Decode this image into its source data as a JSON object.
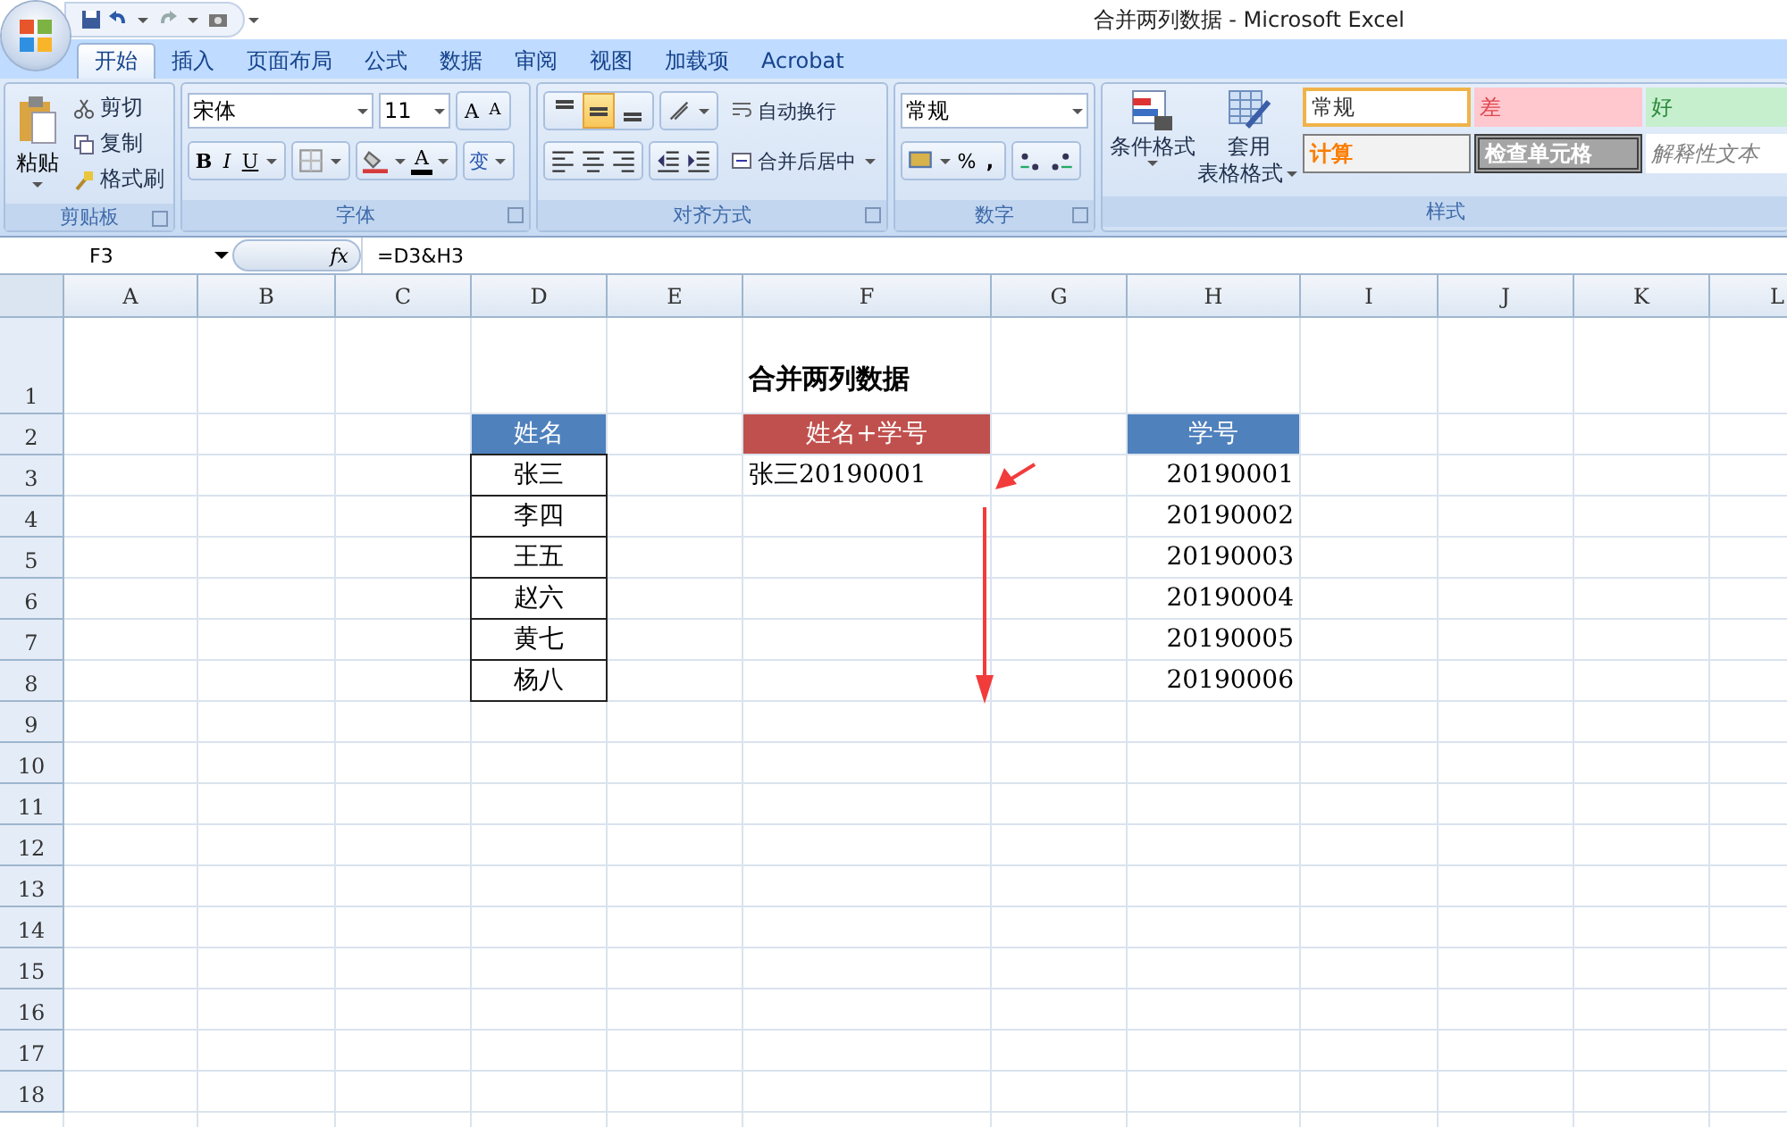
{
  "window": {
    "title": "合并两列数据 - Microsoft Excel"
  },
  "tabs": [
    {
      "label": "开始",
      "selected": true
    },
    {
      "label": "插入",
      "selected": false
    },
    {
      "label": "页面布局",
      "selected": false
    },
    {
      "label": "公式",
      "selected": false
    },
    {
      "label": "数据",
      "selected": false
    },
    {
      "label": "审阅",
      "selected": false
    },
    {
      "label": "视图",
      "selected": false
    },
    {
      "label": "加载项",
      "selected": false
    },
    {
      "label": "Acrobat",
      "selected": false
    }
  ],
  "ribbon": {
    "clipboard": {
      "label": "剪贴板",
      "paste": "粘贴",
      "cut": "剪切",
      "copy": "复制",
      "format_painter": "格式刷"
    },
    "font": {
      "label": "字体",
      "font_name": "宋体",
      "font_size": "11",
      "grow": "A",
      "shrink": "A",
      "bold": "B",
      "italic": "I",
      "underline": "U",
      "font_color": "A",
      "phonetic": "变"
    },
    "alignment": {
      "label": "对齐方式",
      "vertical_align": [
        {
          "selected": false
        },
        {
          "selected": true
        },
        {
          "selected": false
        }
      ],
      "wrap_text": "自动换行",
      "merge_center": "合并后居中"
    },
    "number": {
      "label": "数字",
      "format": "常规",
      "percent": "%",
      "comma": ","
    },
    "styles": {
      "label": "样式",
      "conditional_formatting": "条件格式",
      "format_as_table": [
        "套用",
        "表格格式"
      ],
      "cell_styles": [
        {
          "text": "常规",
          "kind": "normal",
          "selected": true
        },
        {
          "text": "差",
          "kind": "bad",
          "selected": false
        },
        {
          "text": "好",
          "kind": "good",
          "selected": false
        },
        {
          "text": "计算",
          "kind": "calculation",
          "selected": false
        },
        {
          "text": "检查单元格",
          "kind": "check",
          "selected": false
        },
        {
          "text": "解释性文本",
          "kind": "explanatory",
          "selected": false
        }
      ]
    }
  },
  "formula_bar": {
    "name_box": "F3",
    "fx": "fx",
    "formula": "=D3&H3"
  },
  "sheet": {
    "columns": [
      "A",
      "B",
      "C",
      "D",
      "E",
      "F",
      "G",
      "H",
      "I",
      "J",
      "K",
      "L"
    ],
    "rows": [
      "1",
      "2",
      "3",
      "4",
      "5",
      "6",
      "7",
      "8",
      "9",
      "10",
      "11",
      "12",
      "13",
      "14",
      "15",
      "16",
      "17",
      "18"
    ],
    "title": "合并两列数据",
    "blocks": [
      {
        "header": "姓名",
        "color": "#4f81bd",
        "kind": "bordered",
        "items": [
          "张三",
          "李四",
          "王五",
          "赵六",
          "黄七",
          "杨八"
        ]
      },
      {
        "header": "姓名+学号",
        "color": "#c0504d",
        "kind": "text",
        "items": [
          "张三20190001"
        ]
      },
      {
        "header": "学号",
        "color": "#4f81bd",
        "kind": "number",
        "items": [
          "20190001",
          "20190002",
          "20190003",
          "20190004",
          "20190005",
          "20190006"
        ]
      }
    ]
  }
}
